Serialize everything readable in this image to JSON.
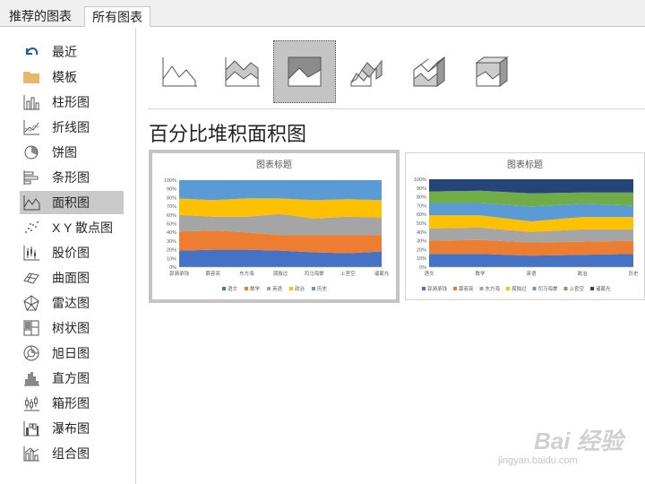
{
  "tabs": [
    "推荐的图表",
    "所有图表"
  ],
  "sidebar": {
    "items": [
      {
        "label": "最近",
        "icon": "recent-icon"
      },
      {
        "label": "模板",
        "icon": "template-folder-icon"
      },
      {
        "label": "柱形图",
        "icon": "column-chart-icon"
      },
      {
        "label": "折线图",
        "icon": "line-chart-icon"
      },
      {
        "label": "饼图",
        "icon": "pie-chart-icon"
      },
      {
        "label": "条形图",
        "icon": "bar-chart-icon"
      },
      {
        "label": "面积图",
        "icon": "area-chart-icon",
        "selected": true
      },
      {
        "label": "X Y 散点图",
        "icon": "scatter-chart-icon"
      },
      {
        "label": "股价图",
        "icon": "stock-chart-icon"
      },
      {
        "label": "曲面图",
        "icon": "surface-chart-icon"
      },
      {
        "label": "雷达图",
        "icon": "radar-chart-icon"
      },
      {
        "label": "树状图",
        "icon": "treemap-chart-icon"
      },
      {
        "label": "旭日图",
        "icon": "sunburst-chart-icon"
      },
      {
        "label": "直方图",
        "icon": "histogram-chart-icon"
      },
      {
        "label": "箱形图",
        "icon": "box-whisker-chart-icon"
      },
      {
        "label": "瀑布图",
        "icon": "waterfall-chart-icon"
      },
      {
        "label": "组合图",
        "icon": "combo-chart-icon"
      }
    ]
  },
  "subtypes": [
    {
      "icon": "area-icon"
    },
    {
      "icon": "stacked-area-icon"
    },
    {
      "icon": "percent-stacked-area-icon",
      "selected": true
    },
    {
      "icon": "3d-area-icon"
    },
    {
      "icon": "3d-stacked-area-icon"
    },
    {
      "icon": "3d-percent-stacked-area-icon"
    }
  ],
  "type_title": "百分比堆积面积图",
  "colors": {
    "palette": [
      "#4472c4",
      "#ed7d31",
      "#a5a5a5",
      "#ffc000",
      "#5b9bd5",
      "#70ad47",
      "#264478"
    ],
    "selected_bg": "#c9c9c9"
  },
  "chart_data": [
    {
      "type": "area",
      "stacking": "percent",
      "title": "图表标题",
      "categories": [
        "郭骑承钱",
        "慕容亮",
        "东方海",
        "孤独过",
        "司马海棠",
        "上官空",
        "诸葛光"
      ],
      "ylim": [
        0,
        100
      ],
      "yticks": [
        "0%",
        "10%",
        "20%",
        "30%",
        "40%",
        "50%",
        "60%",
        "70%",
        "80%",
        "90%",
        "100%"
      ],
      "legend_position": "bottom",
      "series": [
        {
          "name": "语文",
          "color": "#4472c4",
          "values": [
            19,
            20,
            20,
            19,
            17,
            16,
            18
          ]
        },
        {
          "name": "数学",
          "color": "#ed7d31",
          "values": [
            22,
            22,
            20,
            18,
            20,
            21,
            19
          ]
        },
        {
          "name": "英语",
          "color": "#a5a5a5",
          "values": [
            19,
            16,
            18,
            24,
            19,
            21,
            20
          ]
        },
        {
          "name": "政治",
          "color": "#ffc000",
          "values": [
            19,
            19,
            21,
            18,
            21,
            20,
            20
          ]
        },
        {
          "name": "历史",
          "color": "#5b9bd5",
          "values": [
            21,
            23,
            21,
            21,
            23,
            22,
            23
          ]
        }
      ]
    },
    {
      "type": "area",
      "stacking": "percent",
      "title": "图表标题",
      "categories": [
        "语文",
        "数学",
        "英语",
        "政治",
        "历史"
      ],
      "ylim": [
        0,
        100
      ],
      "yticks": [
        "0%",
        "10%",
        "20%",
        "30%",
        "40%",
        "50%",
        "60%",
        "70%",
        "80%",
        "90%",
        "100%"
      ],
      "legend_position": "bottom",
      "series": [
        {
          "name": "郭骑承钱",
          "color": "#4472c4",
          "values": [
            15,
            15,
            13,
            14,
            15
          ]
        },
        {
          "name": "慕容亮",
          "color": "#ed7d31",
          "values": [
            15,
            16,
            15,
            15,
            15
          ]
        },
        {
          "name": "东方海",
          "color": "#a5a5a5",
          "values": [
            14,
            14,
            12,
            14,
            13
          ]
        },
        {
          "name": "孤独过",
          "color": "#ffc000",
          "values": [
            15,
            14,
            12,
            14,
            14
          ]
        },
        {
          "name": "司马海棠",
          "color": "#5b9bd5",
          "values": [
            14,
            14,
            17,
            15,
            13
          ]
        },
        {
          "name": "上官空",
          "color": "#70ad47",
          "values": [
            13,
            14,
            15,
            13,
            15
          ]
        },
        {
          "name": "诸葛光",
          "color": "#264478",
          "values": [
            14,
            13,
            16,
            15,
            15
          ]
        }
      ]
    }
  ],
  "watermark": {
    "text": "Bai 经验",
    "url": "jingyan.baidu.com"
  }
}
